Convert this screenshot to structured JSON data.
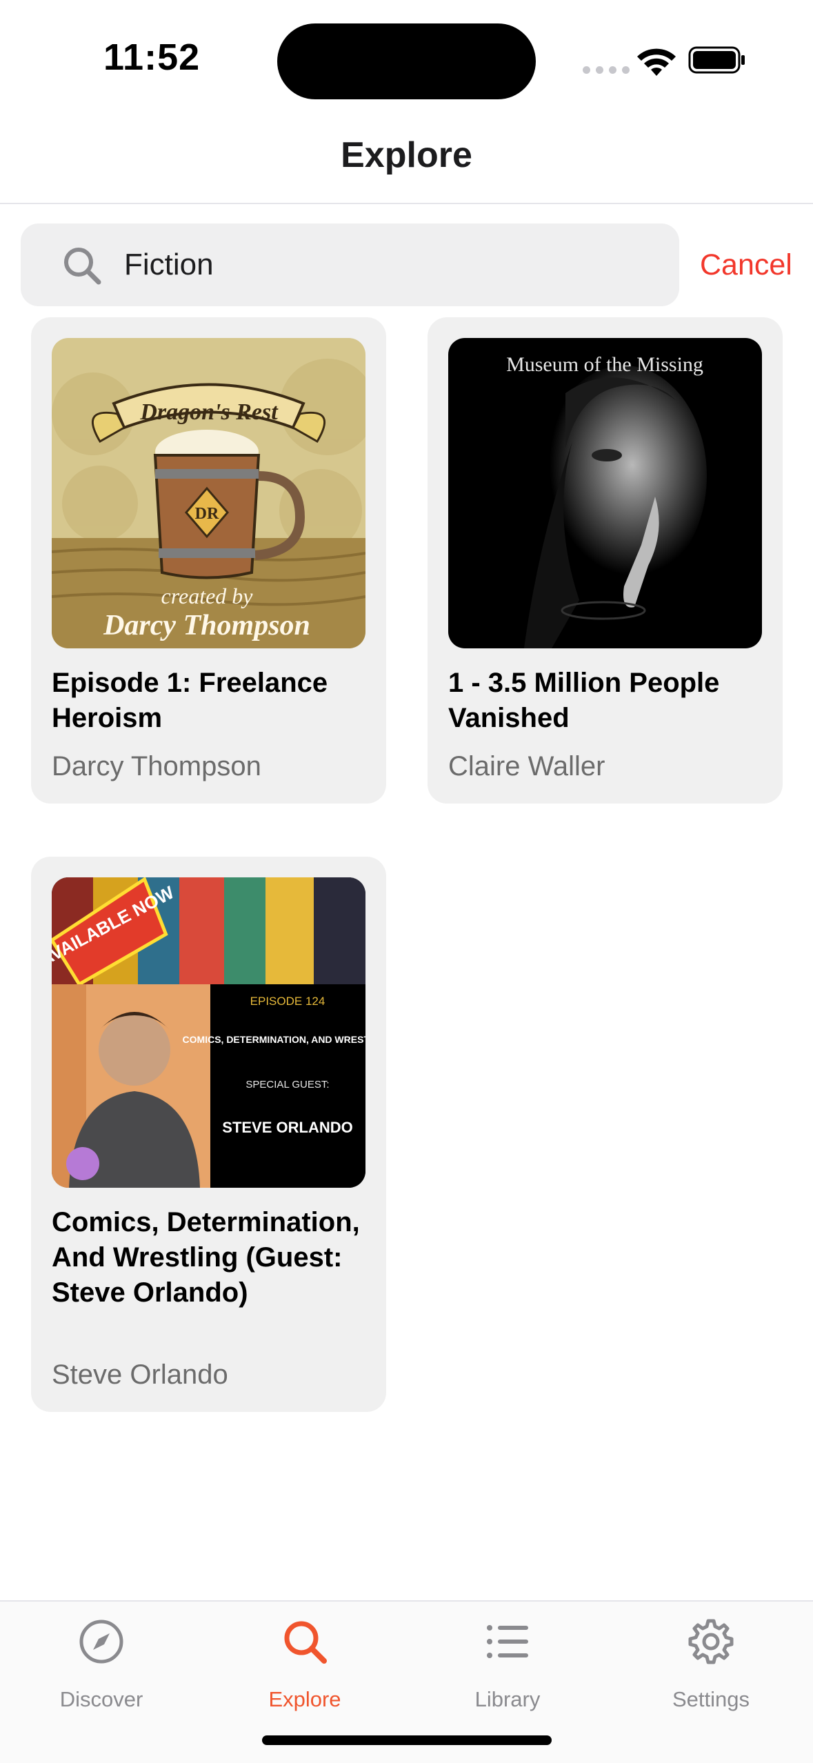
{
  "status_bar": {
    "time": "11:52"
  },
  "nav": {
    "title": "Explore"
  },
  "search": {
    "value": "Fiction",
    "cancel_label": "Cancel"
  },
  "results": [
    {
      "title": "Episode 1: Freelance Heroism",
      "author": "Darcy Thompson",
      "artwork": {
        "banner_text": "Dragon's Rest",
        "badge": "DR",
        "line1": "created by",
        "line2": "Darcy Thompson"
      }
    },
    {
      "title": "1 - 3.5 Million People Vanished",
      "author": "Claire Waller",
      "artwork": {
        "heading": "Museum of the Missing"
      }
    },
    {
      "title": "Comics, Determination, And Wrestling (Guest: Steve Orlando)",
      "author": "Steve Orlando",
      "artwork": {
        "stamp": "AVAILABLE NOW",
        "episode": "EPISODE 124",
        "topic": "COMICS, DETERMINATION, AND WRESTLING",
        "guest_label": "SPECIAL GUEST:",
        "guest_name": "STEVE ORLANDO"
      }
    }
  ],
  "tabs": [
    {
      "label": "Discover",
      "icon": "compass-icon",
      "active": false
    },
    {
      "label": "Explore",
      "icon": "search-icon",
      "active": true
    },
    {
      "label": "Library",
      "icon": "list-icon",
      "active": false
    },
    {
      "label": "Settings",
      "icon": "gear-icon",
      "active": false
    }
  ],
  "colors": {
    "accent": "#f0552d",
    "cancel": "#f2372b",
    "inactive": "#8a8a8e",
    "card_bg": "#f0f0f0"
  }
}
